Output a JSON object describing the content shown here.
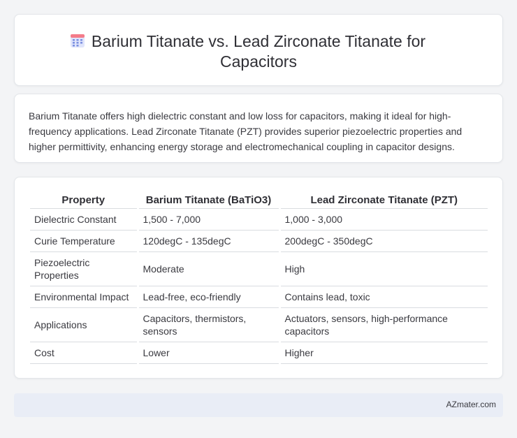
{
  "header": {
    "title": "Barium Titanate vs. Lead Zirconate Titanate for Capacitors",
    "icon": "calendar-icon"
  },
  "summary": {
    "text": "Barium Titanate offers high dielectric constant and low loss for capacitors, making it ideal for high-frequency applications. Lead Zirconate Titanate (PZT) provides superior piezoelectric properties and higher permittivity, enhancing energy storage and electromechanical coupling in capacitor designs."
  },
  "table": {
    "headers": [
      "Property",
      "Barium Titanate (BaTiO3)",
      "Lead Zirconate Titanate (PZT)"
    ],
    "rows": [
      [
        "Dielectric Constant",
        "1,500 - 7,000",
        "1,000 - 3,000"
      ],
      [
        "Curie Temperature",
        "120degC - 135degC",
        "200degC - 350degC"
      ],
      [
        "Piezoelectric Properties",
        "Moderate",
        "High"
      ],
      [
        "Environmental Impact",
        "Lead-free, eco-friendly",
        "Contains lead, toxic"
      ],
      [
        "Applications",
        "Capacitors, thermistors, sensors",
        "Actuators, sensors, high-performance capacitors"
      ],
      [
        "Cost",
        "Lower",
        "Higher"
      ]
    ]
  },
  "footer": {
    "text": "AZmater.com"
  },
  "colors": {
    "background": "#f3f4f6",
    "card": "#ffffff",
    "footer_bg": "#e9edf6",
    "icon_accent": "#7b8fe0",
    "icon_top": "#f47c8a"
  }
}
